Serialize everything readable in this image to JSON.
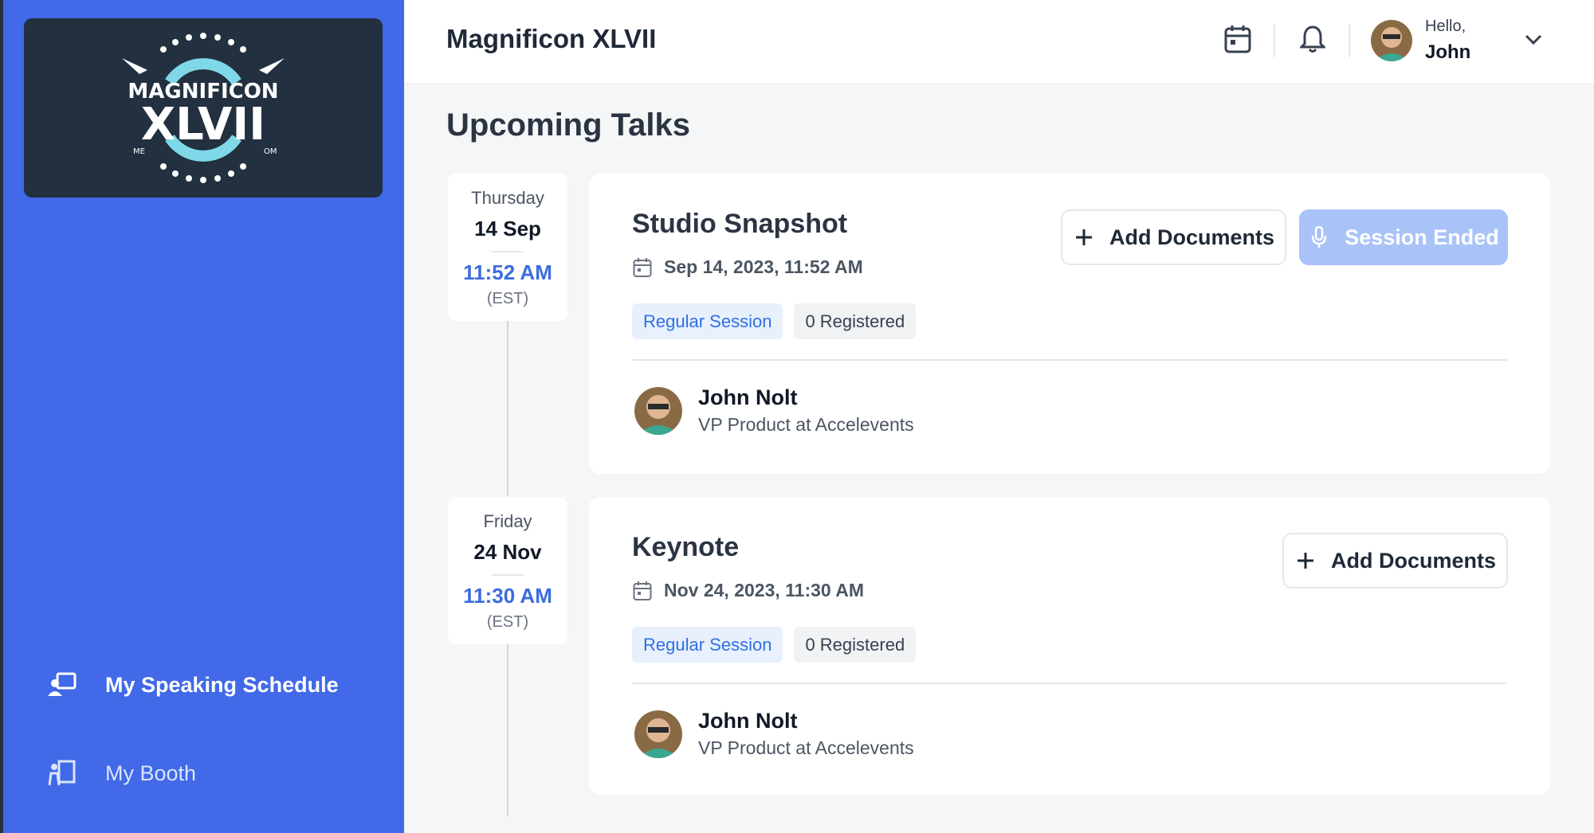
{
  "app": {
    "title": "Magnificon XLVII"
  },
  "logo": {
    "line1": "MAGNIFICON",
    "line2": "XLVII",
    "left_small": "ME",
    "right_small": "OM"
  },
  "sidebar": {
    "items": [
      {
        "label": "My Speaking Schedule",
        "icon": "presenter-board-icon",
        "active": true
      },
      {
        "label": "My Booth",
        "icon": "booth-icon",
        "active": false
      }
    ]
  },
  "header": {
    "greeting": "Hello,",
    "user_name": "John",
    "icons": [
      "calendar-icon",
      "bell-icon",
      "chevron-down-icon"
    ]
  },
  "page": {
    "title": "Upcoming Talks"
  },
  "talks": [
    {
      "date": {
        "weekday": "Thursday",
        "day_month": "14 Sep",
        "time": "11:52 AM",
        "tz": "(EST)"
      },
      "title": "Studio Snapshot",
      "datetime": "Sep 14, 2023, 11:52 AM",
      "session_type": "Regular Session",
      "registered": "0 Registered",
      "add_documents_label": "Add Documents",
      "status_label": "Session Ended",
      "speaker": {
        "name": "John Nolt",
        "role": "VP Product at Accelevents"
      }
    },
    {
      "date": {
        "weekday": "Friday",
        "day_month": "24 Nov",
        "time": "11:30 AM",
        "tz": "(EST)"
      },
      "title": "Keynote",
      "datetime": "Nov 24, 2023, 11:30 AM",
      "session_type": "Regular Session",
      "registered": "0 Registered",
      "add_documents_label": "Add Documents",
      "speaker": {
        "name": "John Nolt",
        "role": "VP Product at Accelevents"
      }
    }
  ],
  "colors": {
    "sidebar": "#4169e8",
    "logo_bg": "#22303f",
    "accent": "#3b6ce0",
    "ended_button": "#a9c3f8"
  }
}
